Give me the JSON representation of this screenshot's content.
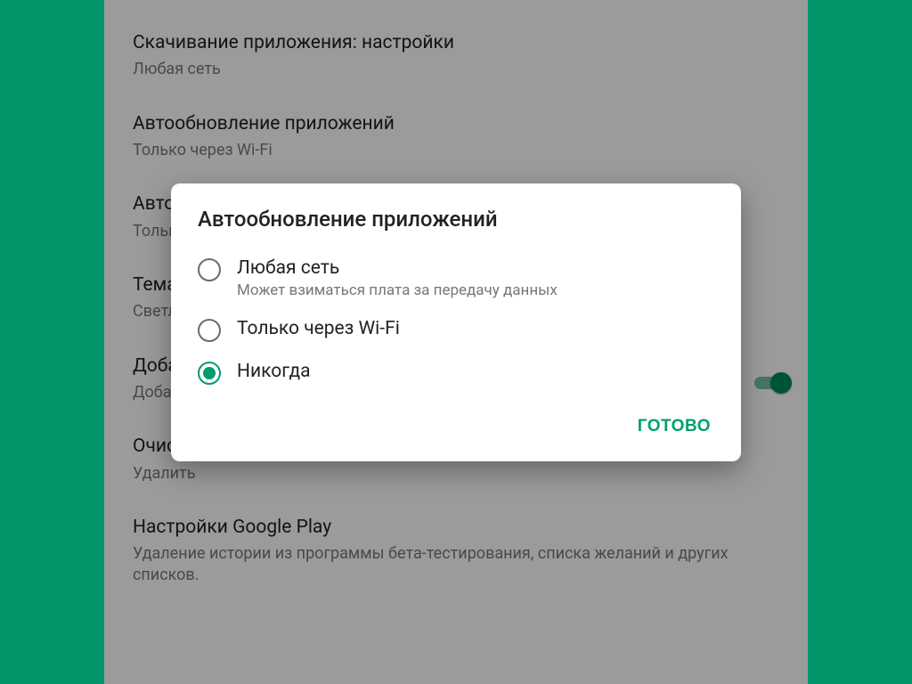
{
  "settings": [
    {
      "title": "Скачивание приложения: настройки",
      "sub": "Любая сеть",
      "switch": false
    },
    {
      "title": "Автообновление приложений",
      "sub": "Только через Wi-Fi",
      "switch": false
    },
    {
      "title": "Автома",
      "sub": "Только ч",
      "switch": false
    },
    {
      "title": "Тема",
      "sub": "Светлая",
      "switch": false
    },
    {
      "title": "Добавл",
      "sub": "Добавля",
      "switch": true
    },
    {
      "title": "Очисти",
      "sub": "Удалить",
      "switch": false
    },
    {
      "title": "Настройки Google Play",
      "sub": "Удаление истории из программы бета-тестирования, списка желаний и других списков.",
      "switch": false
    }
  ],
  "dialog": {
    "title": "Автообновление приложений",
    "options": [
      {
        "label": "Любая сеть",
        "sub": "Может взиматься плата за передачу данных",
        "checked": false
      },
      {
        "label": "Только через Wi-Fi",
        "sub": "",
        "checked": false
      },
      {
        "label": "Никогда",
        "sub": "",
        "checked": true
      }
    ],
    "done": "ГОТОВО"
  },
  "colors": {
    "accent": "#009e6e",
    "brand_bg": "#00966a"
  }
}
